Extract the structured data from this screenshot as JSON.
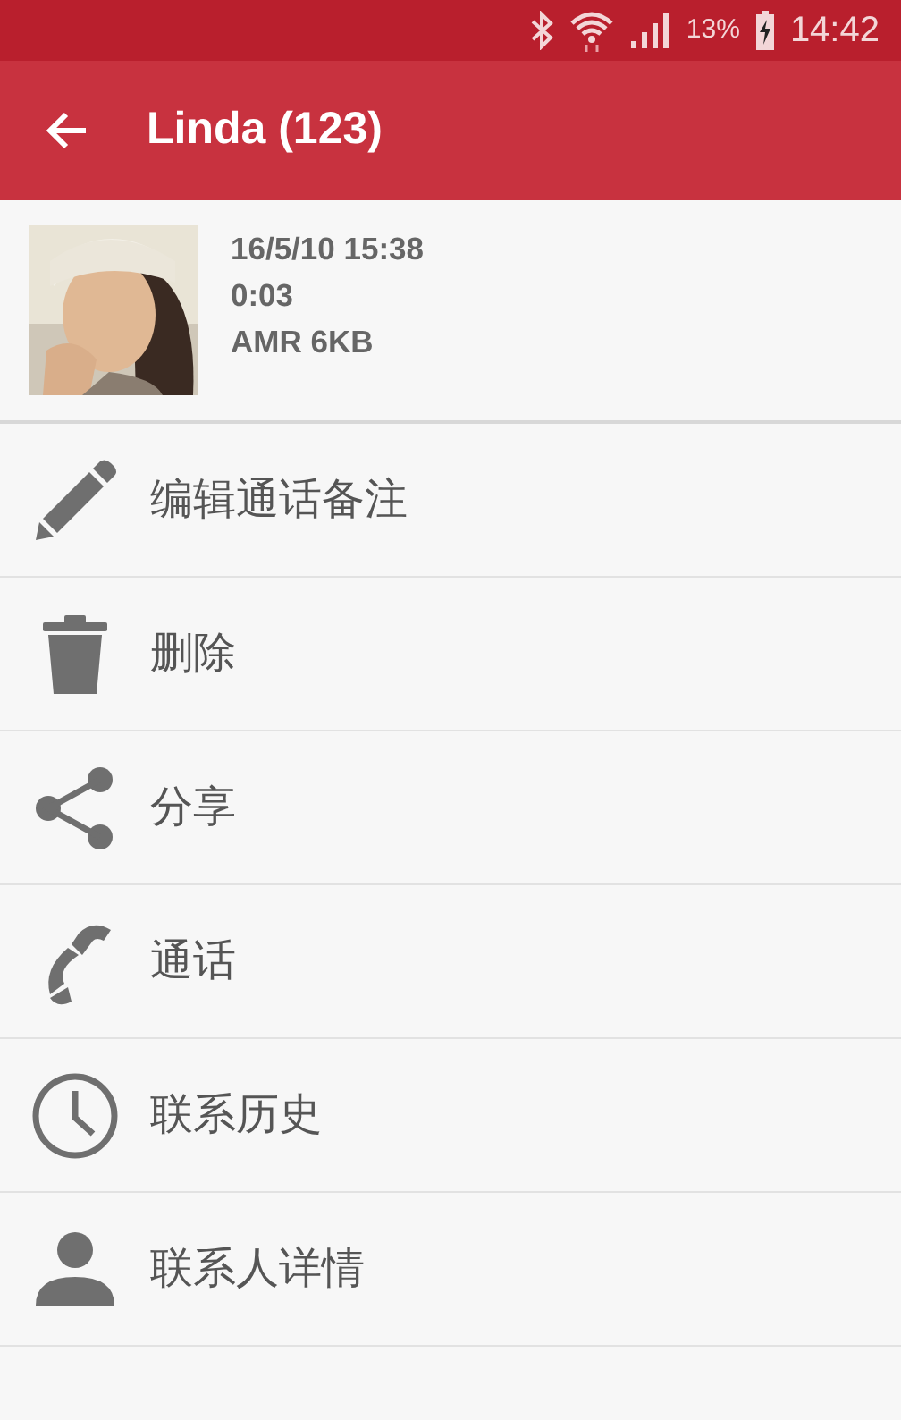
{
  "status_bar": {
    "battery": "13%",
    "time": "14:42"
  },
  "app_bar": {
    "title": "Linda (123)"
  },
  "recording": {
    "date": "16/5/10  15:38",
    "duration": "0:03",
    "format": "AMR 6KB"
  },
  "actions": [
    {
      "label": "编辑通话备注"
    },
    {
      "label": "删除"
    },
    {
      "label": "分享"
    },
    {
      "label": "通话"
    },
    {
      "label": "联系历史"
    },
    {
      "label": "联系人详情"
    }
  ]
}
